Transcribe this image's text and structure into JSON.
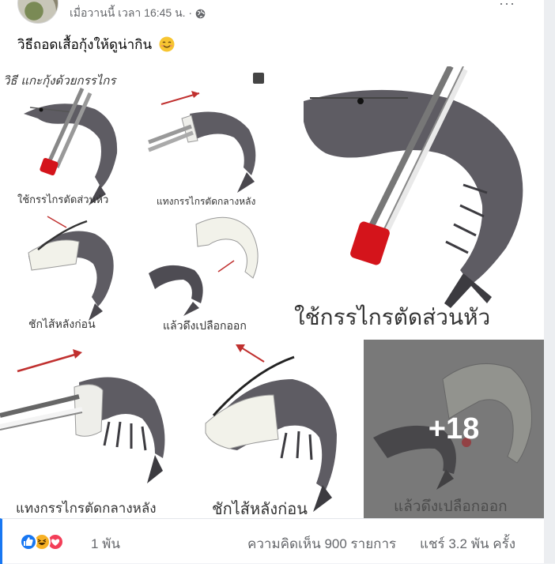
{
  "post": {
    "timestamp": "เมื่อวานนี้ เวลา 16:45 น. ·",
    "more_glyph": "···",
    "caption": "วิธีถอดเสื้อกุ้งให้ดูน่ากิน"
  },
  "photos": {
    "infographic": {
      "title": "วิธี แกะกุ้งด้วยกรรไกร",
      "step1": "ใช้กรรไกรตัดส่วนหัว",
      "step2": "แทงกรรไกรตัดกลางหลัง",
      "step3": "ชักไส้หลังก่อน",
      "step4": "แล้วดึงเปลือกออก"
    },
    "big": "ใช้กรรไกรตัดส่วนหัว",
    "bottom_left": "แทงกรรไกรตัดกลางหลัง",
    "bottom_mid": "ชักไส้หลังก่อน",
    "bottom_right": "แล้วดึงเปลือกออก",
    "more_count": "+18"
  },
  "footer": {
    "reaction_icons": [
      "like-icon",
      "haha-icon",
      "love-icon"
    ],
    "reaction_count": "1 พัน",
    "comments": "ความคิดเห็น 900 รายการ",
    "shares": "แชร์ 3.2 พัน ครั้ง"
  },
  "colors": {
    "facebook_blue": "#1877f2",
    "text_secondary": "#65676b",
    "shrimp_grey": "#5e5c63",
    "scissor_red": "#d4141b"
  }
}
